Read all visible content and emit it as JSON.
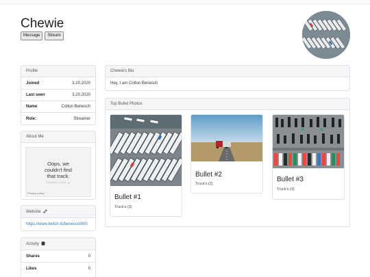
{
  "profile": {
    "name": "Chewie",
    "buttons": {
      "message": "Message",
      "stream": "Stream"
    }
  },
  "profile_card": {
    "header": "Profile",
    "rows": [
      {
        "key": "Joined",
        "value": "3.20.2020"
      },
      {
        "key": "Last seen",
        "value": "3.20.2020"
      },
      {
        "key": "Name",
        "value": "Colton Benesch"
      },
      {
        "key": "Role:",
        "value": "Streamer"
      }
    ]
  },
  "about_me": {
    "header": "About Me",
    "embed_line1": "Oops, we",
    "embed_line2": "couldn't find",
    "embed_line3": "that track.",
    "embed_brand": "SOUNDCLOUD",
    "embed_privacy": "Privacy policy"
  },
  "website": {
    "header": "Website",
    "icon": "link-icon",
    "url": "https://www.twitch.tv/benescol000"
  },
  "activity": {
    "header": "Activity",
    "icon": "database-icon",
    "rows": [
      {
        "key": "Shares",
        "value": "0"
      },
      {
        "key": "Likes",
        "value": "0"
      }
    ]
  },
  "bio": {
    "header": "Chewie's Bio",
    "text": "Hey, I am Colton Benesch"
  },
  "top_bullets": {
    "header": "Top Bullet Photos",
    "items": [
      {
        "title": "Bullet #1",
        "sub": "Truck's (3)"
      },
      {
        "title": "Bullet #2",
        "sub": "Truck's (2)"
      },
      {
        "title": "Bullet #3",
        "sub": "Truck's (3)"
      }
    ]
  }
}
